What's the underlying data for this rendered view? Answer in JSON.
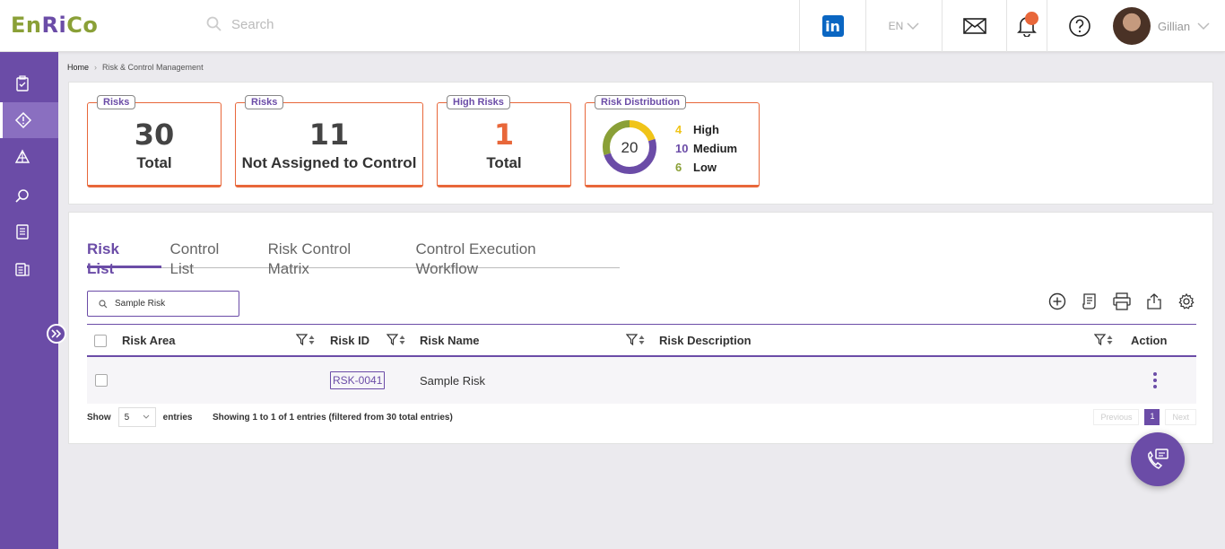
{
  "brand": {
    "part1": "En",
    "part2": "Ri",
    "part3": "Co"
  },
  "header": {
    "search_placeholder": "Search",
    "language": "EN",
    "user_name": "Gillian"
  },
  "breadcrumb": {
    "home": "Home",
    "current": "Risk & Control Management"
  },
  "cards": {
    "risks_total": {
      "tag": "Risks",
      "value": "30",
      "label": "Total"
    },
    "risks_unassigned": {
      "tag": "Risks",
      "value": "11",
      "label": "Not Assigned to Control"
    },
    "high_risks": {
      "tag": "High Risks",
      "value": "1",
      "label": "Total"
    },
    "distribution": {
      "tag": "Risk Distribution",
      "total": "20",
      "items": [
        {
          "count": "4",
          "label": "High",
          "color": "#f0c419"
        },
        {
          "count": "10",
          "label": "Medium",
          "color": "#6b4ca7"
        },
        {
          "count": "6",
          "label": "Low",
          "color": "#8aa037"
        }
      ]
    }
  },
  "tabs": [
    "Risk List",
    "Control List",
    "Risk Control Matrix",
    "Control Execution Workflow"
  ],
  "table": {
    "search_value": "Sample Risk",
    "columns": {
      "area": "Risk Area",
      "id": "Risk ID",
      "name": "Risk Name",
      "description": "Risk Description",
      "action": "Action"
    },
    "rows": [
      {
        "area": "",
        "id": "RSK-0041",
        "name": "Sample Risk",
        "description": ""
      }
    ]
  },
  "footer": {
    "show_label": "Show",
    "page_size": "5",
    "entries_label": "entries",
    "summary": "Showing 1 to 1 of 1 entries (filtered from 30 total entries)",
    "previous": "Previous",
    "page": "1",
    "next": "Next"
  },
  "colors": {
    "primary": "#6b4ca7",
    "accent": "#e8673a",
    "green": "#8aa037",
    "yellow": "#f0c419"
  }
}
